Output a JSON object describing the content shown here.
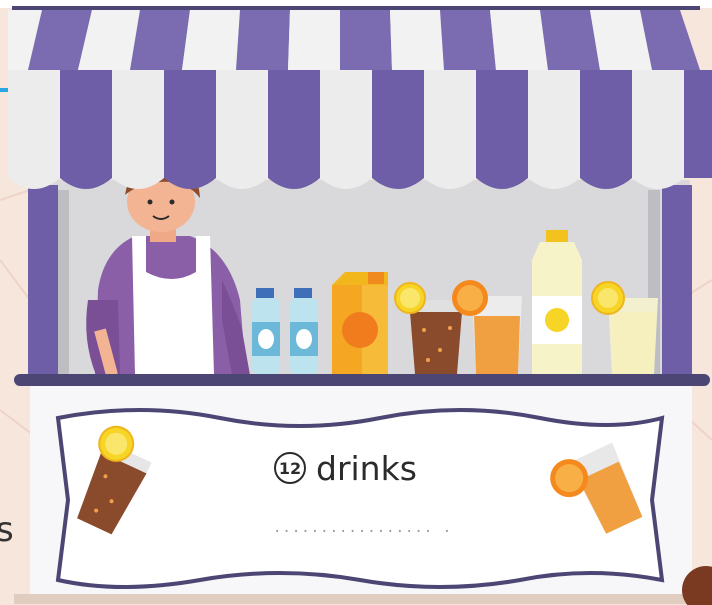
{
  "sign": {
    "number": "12",
    "word": "drinks",
    "answer_blank": "................. ."
  },
  "edge_text": "s",
  "colors": {
    "awning_purple": "#7b6cb2",
    "awning_white": "#f2f2f2",
    "post_purple": "#6e5ea8",
    "counter_dark": "#4b4673",
    "background": "#f7e6dc",
    "sign_border": "#4b4673"
  },
  "items": [
    "water-bottle",
    "water-bottle",
    "juice-carton",
    "cola-glass",
    "orange-juice-glass",
    "lemonade-bottle",
    "lemonade-glass"
  ]
}
